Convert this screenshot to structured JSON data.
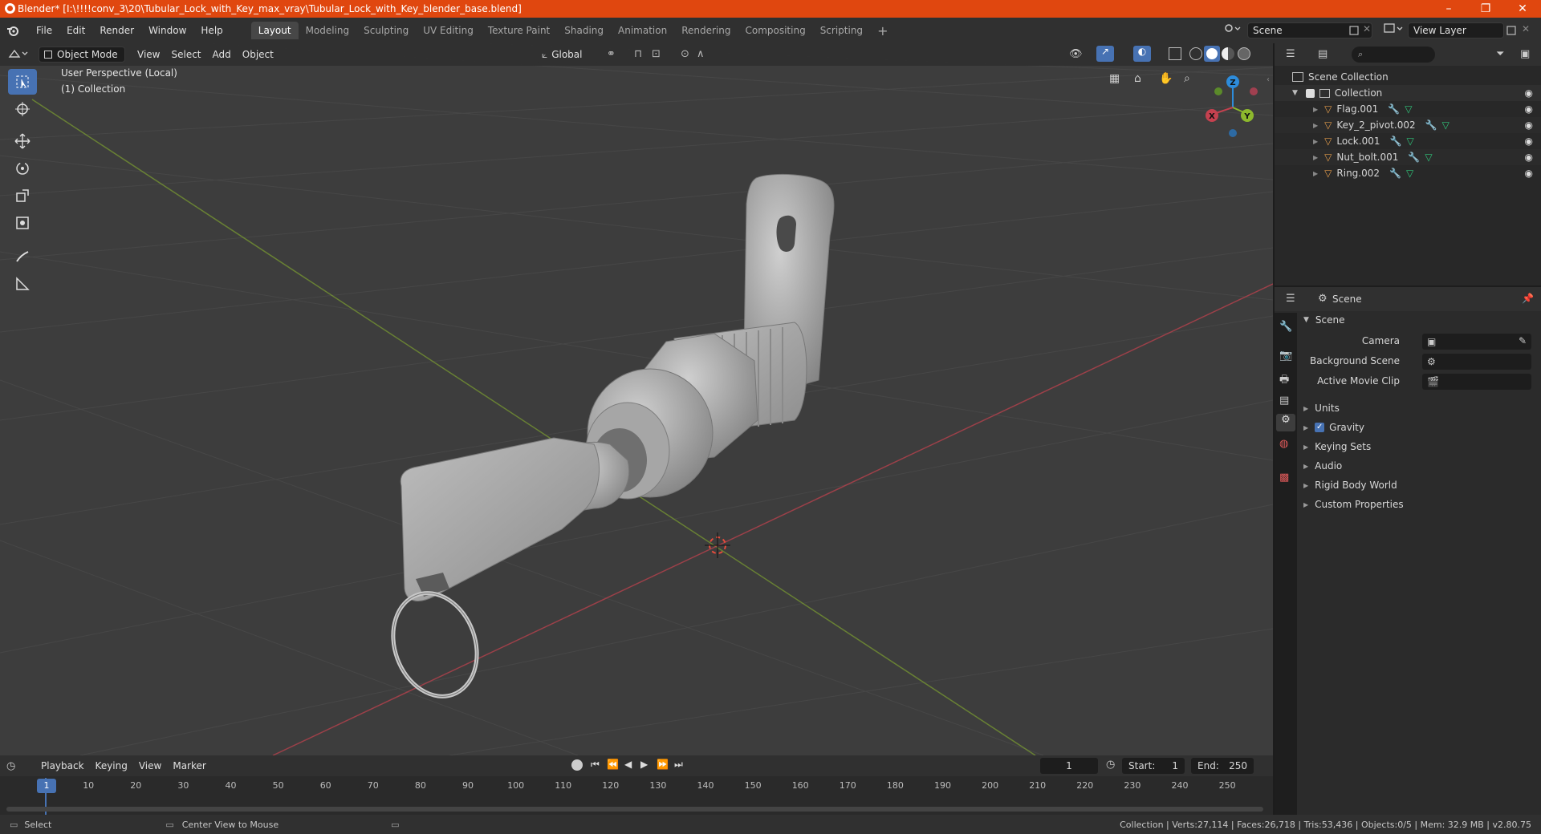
{
  "window": {
    "title": "Blender* [I:\\!!!!conv_3\\20\\Tubular_Lock_with_Key_max_vray\\Tubular_Lock_with_Key_blender_base.blend]",
    "minimize": "–",
    "restore": "❐",
    "close": "✕"
  },
  "menubar": {
    "menus": [
      "File",
      "Edit",
      "Render",
      "Window",
      "Help"
    ],
    "workspaces": [
      "Layout",
      "Modeling",
      "Sculpting",
      "UV Editing",
      "Texture Paint",
      "Shading",
      "Animation",
      "Rendering",
      "Compositing",
      "Scripting"
    ],
    "add_workspace": "+",
    "scene_label": "Scene",
    "view_layer_label": "View Layer"
  },
  "viewport": {
    "mode": "Object Mode",
    "menus": [
      "View",
      "Select",
      "Add",
      "Object"
    ],
    "transform_orientation": "Global",
    "info_line1": "User Perspective (Local)",
    "info_line2": "(1) Collection",
    "gizmo": {
      "x": "X",
      "y": "Y",
      "z": "Z"
    }
  },
  "outliner": {
    "search_placeholder": "",
    "scene_collection": "Scene Collection",
    "collection": "Collection",
    "objects": [
      "Flag.001",
      "Key_2_pivot.002",
      "Lock.001",
      "Nut_bolt.001",
      "Ring.002"
    ]
  },
  "properties": {
    "header": "Scene",
    "panel_title": "Scene",
    "camera_label": "Camera",
    "background_scene_label": "Background Scene",
    "active_movie_clip_label": "Active Movie Clip",
    "sections": [
      "Units",
      "Gravity",
      "Keying Sets",
      "Audio",
      "Rigid Body World",
      "Custom Properties"
    ],
    "gravity_checked": true
  },
  "timeline": {
    "menus": [
      "Playback",
      "Keying",
      "View",
      "Marker"
    ],
    "current_frame": "1",
    "start_label": "Start:",
    "start_value": "1",
    "end_label": "End:",
    "end_value": "250",
    "ruler": [
      "1",
      "10",
      "20",
      "30",
      "40",
      "50",
      "60",
      "70",
      "80",
      "90",
      "100",
      "110",
      "120",
      "130",
      "140",
      "150",
      "160",
      "170",
      "180",
      "190",
      "200",
      "210",
      "220",
      "230",
      "240",
      "250"
    ]
  },
  "statusbar": {
    "left_action": "Select",
    "middle_action": "Center View to Mouse",
    "stats": "Collection | Verts:27,114 | Faces:26,718 | Tris:53,436 | Objects:0/5 | Mem: 32.9 MB | v2.80.75"
  },
  "colors": {
    "title_bar": "#e0470f",
    "active_blue": "#4772b3",
    "x_axis": "#c4414f",
    "y_axis": "#8db82d",
    "z_axis": "#2d8cdb",
    "object_orange": "#e09a4a"
  }
}
